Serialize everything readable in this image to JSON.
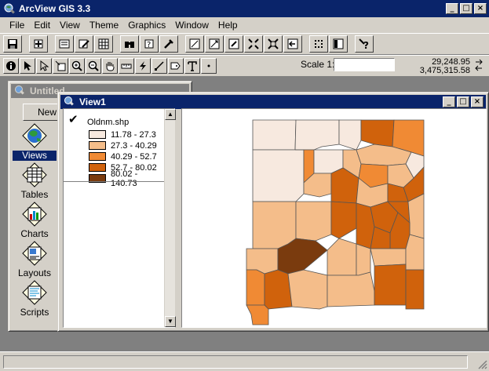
{
  "app": {
    "title": "ArcView GIS 3.3",
    "title_buttons": [
      "_",
      "□",
      "×"
    ]
  },
  "menu": {
    "items": [
      "File",
      "Edit",
      "View",
      "Theme",
      "Graphics",
      "Window",
      "Help"
    ],
    "accel": [
      "F",
      "E",
      "V",
      "T",
      "G",
      "W",
      "H"
    ]
  },
  "button_bar": {
    "icons": [
      "save-icon",
      "add-theme-icon",
      "theme-properties-icon",
      "edit-legend-icon",
      "open-table-icon",
      "find-icon",
      "locate-address-icon",
      "query-builder-icon",
      "zoom-to-full-extent-icon",
      "zoom-to-themes-icon",
      "zoom-to-selected-icon",
      "zoom-in-icon",
      "zoom-out-icon",
      "zoom-previous-icon",
      "select-by-graphic-icon",
      "clear-selected-icon",
      "help-icon"
    ]
  },
  "tool_bar": {
    "icons": [
      "identify-icon",
      "pointer-icon",
      "vertex-edit-icon",
      "select-feature-icon",
      "zoom-in-tool-icon",
      "zoom-out-tool-icon",
      "pan-icon",
      "measure-icon",
      "hot-link-icon",
      "area-of-interest-icon",
      "label-icon",
      "text-icon",
      "draw-point-icon"
    ],
    "scale_label": "Scale 1:",
    "scale_value": "",
    "coord_x": "29,248.95",
    "coord_y": "3,475,315.58"
  },
  "project_window": {
    "title": "Untitled",
    "new_button": "New",
    "doc_types": [
      {
        "label": "Views",
        "icon": "views-icon",
        "selected": true
      },
      {
        "label": "Tables",
        "icon": "tables-icon",
        "selected": false
      },
      {
        "label": "Charts",
        "icon": "charts-icon",
        "selected": false
      },
      {
        "label": "Layouts",
        "icon": "layouts-icon",
        "selected": false
      },
      {
        "label": "Scripts",
        "icon": "scripts-icon",
        "selected": false
      }
    ]
  },
  "view_window": {
    "title": "View1",
    "theme": {
      "name": "Oldnm.shp",
      "visible": true,
      "legend": [
        {
          "label": "11.78 - 27.3",
          "color": "#f7e9df"
        },
        {
          "label": "27.3 - 40.29",
          "color": "#f4bd8a"
        },
        {
          "label": "40.29 - 52.7",
          "color": "#f08a34"
        },
        {
          "label": "52.7 - 80.02",
          "color": "#d0620c"
        },
        {
          "label": "80.02 - 140.73",
          "color": "#7a3b0e"
        }
      ]
    }
  },
  "colors": {
    "titlebar_active": "#0a246a",
    "titlebar_inactive": "#808080",
    "face": "#d4d0c8"
  }
}
